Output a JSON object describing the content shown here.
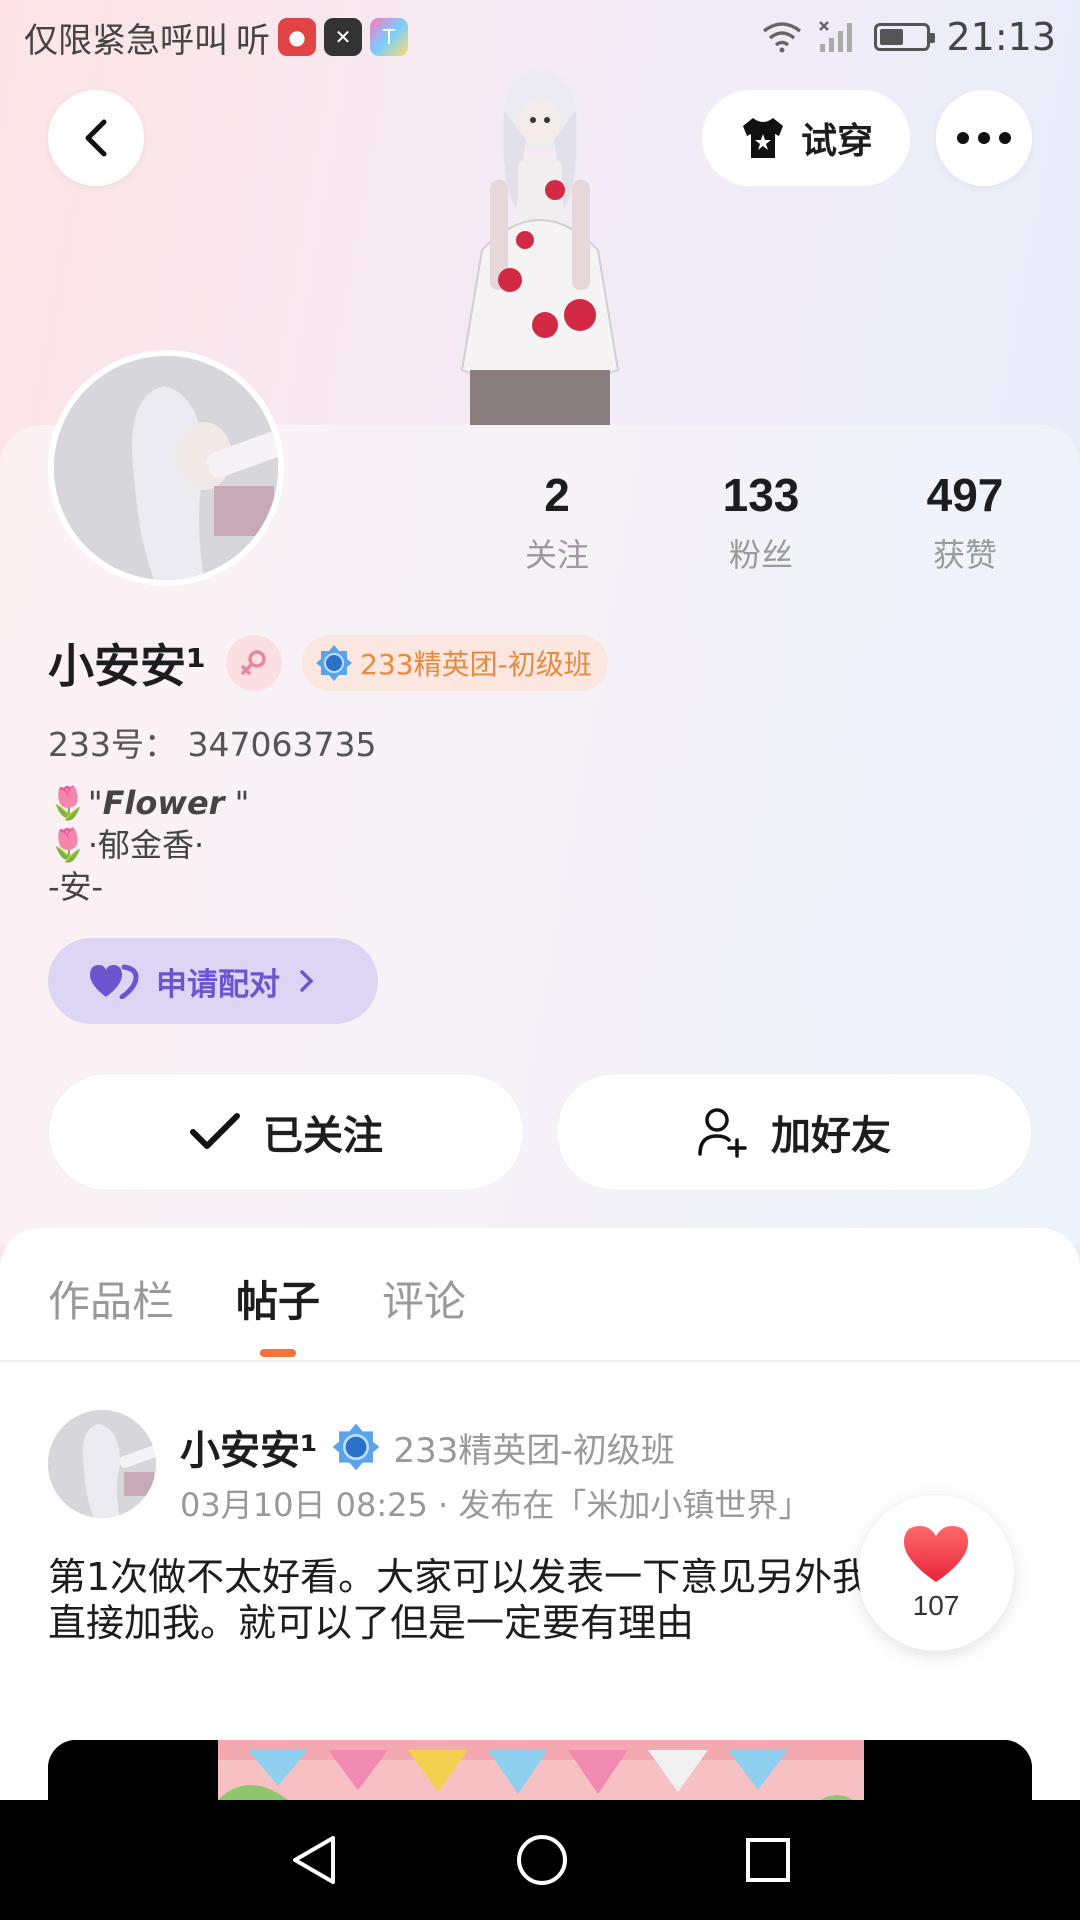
{
  "status_bar": {
    "carrier_text": "仅限紧急呼叫",
    "listen_text": "听",
    "time": "21:13"
  },
  "header": {
    "try_on_label": "试穿"
  },
  "profile": {
    "stats": [
      {
        "num": "2",
        "label": "关注"
      },
      {
        "num": "133",
        "label": "粉丝"
      },
      {
        "num": "497",
        "label": "获赞"
      }
    ],
    "name": "小安安¹",
    "badge": "233精英团-初级班",
    "id_line": "233号： 347063735",
    "bio_line1_quote_open": "\"",
    "bio_line1_bold": "Flower",
    "bio_line1_quote_close": " \"",
    "bio_line2": "·郁金香·",
    "bio_line3": "-安-",
    "pair_label": "申请配对",
    "followed_label": "已关注",
    "add_friend_label": "加好友"
  },
  "tabs": [
    {
      "label": "作品栏",
      "active": false
    },
    {
      "label": "帖子",
      "active": true
    },
    {
      "label": "评论",
      "active": false
    }
  ],
  "post": {
    "author": "小安安¹",
    "badge": "233精英团-初级班",
    "meta": "03月10日 08:25 · 发布在「米加小镇世界」",
    "text": "第1次做不太好看。大家可以发表一下意见另外我想交友。直接加我。就可以了但是一定要有理由",
    "likes": "107"
  },
  "colors": {
    "accent_orange": "#f2743b",
    "pair_purple": "#6b56d0",
    "badge_orange": "#e88a3d",
    "like_red": "#f03a4a"
  }
}
